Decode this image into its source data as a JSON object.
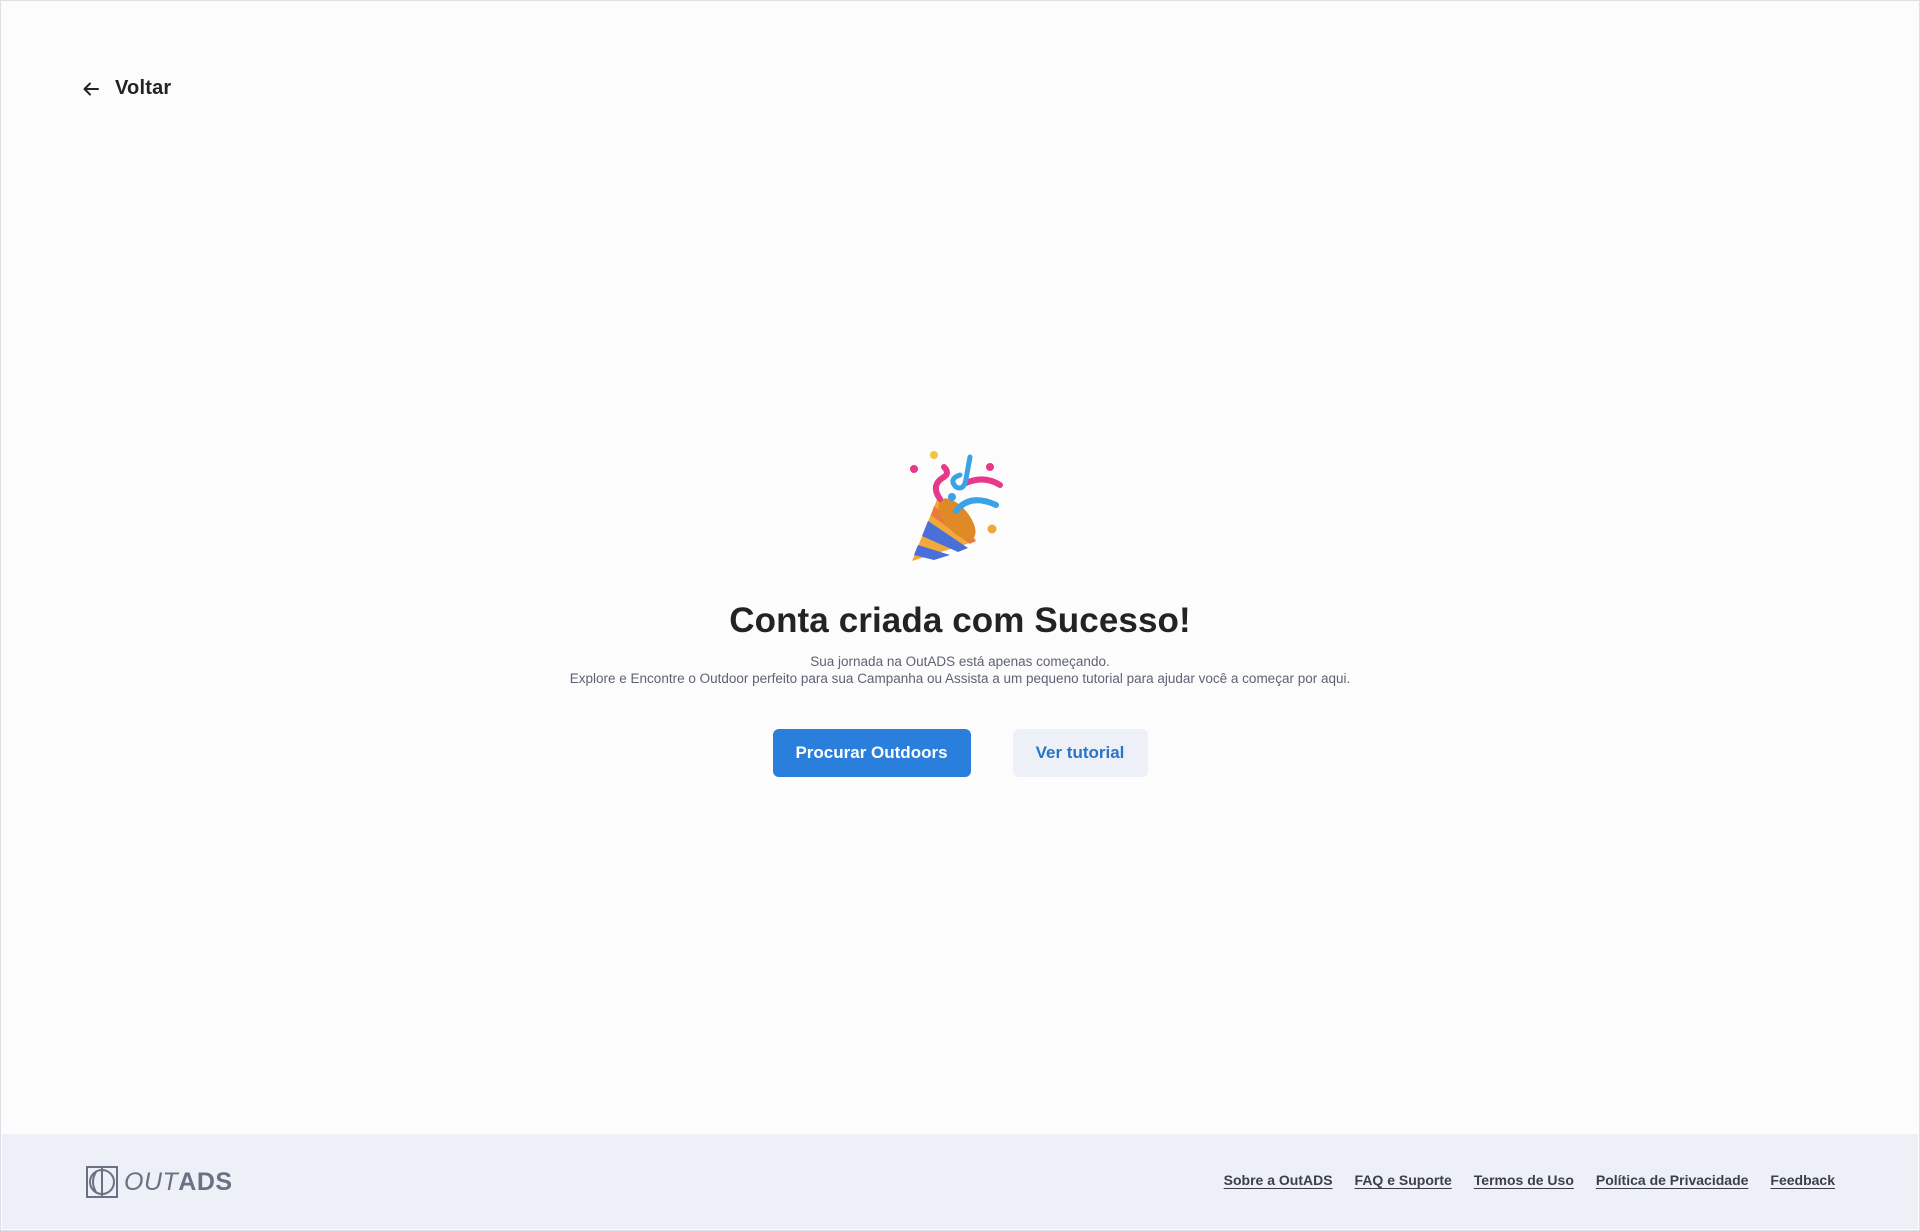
{
  "header": {
    "back_label": "Voltar"
  },
  "main": {
    "title": "Conta criada com Sucesso!",
    "subtitle_line1": "Sua jornada na OutADS está apenas começando.",
    "subtitle_line2": "Explore e Encontre o Outdoor perfeito para sua Campanha ou Assista a um pequeno tutorial para ajudar você a começar por aqui.",
    "primary_button": "Procurar Outdoors",
    "secondary_button": "Ver tutorial"
  },
  "footer": {
    "logo_light": "OUT",
    "logo_bold": "ADS",
    "links": [
      "Sobre a OutADS",
      "FAQ e Suporte",
      "Termos de Uso",
      "Política de Privacidade",
      "Feedback"
    ]
  },
  "colors": {
    "accent": "#2a7fdd",
    "footer_bg": "#edf1f7",
    "secondary_button_bg": "#edf1f7",
    "text_dark": "#232323",
    "text_muted": "#5d6374"
  },
  "icons": {
    "back": "arrow-left-icon",
    "celebration": "party-popper-icon",
    "logo": "outads-logo-icon"
  }
}
